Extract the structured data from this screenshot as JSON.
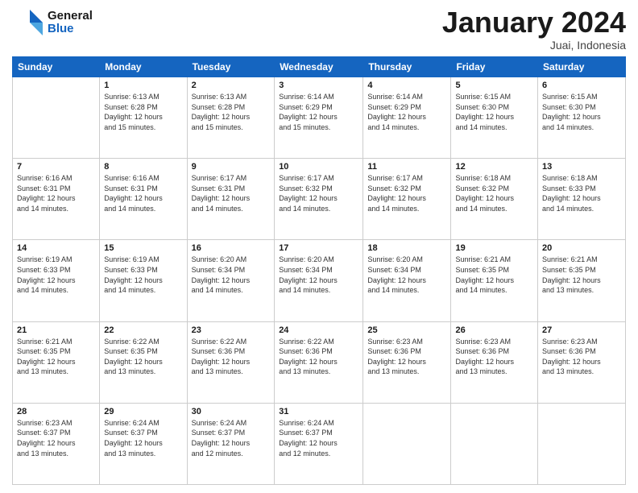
{
  "header": {
    "logo_general": "General",
    "logo_blue": "Blue",
    "month_title": "January 2024",
    "location": "Juai, Indonesia"
  },
  "days_of_week": [
    "Sunday",
    "Monday",
    "Tuesday",
    "Wednesday",
    "Thursday",
    "Friday",
    "Saturday"
  ],
  "weeks": [
    [
      {
        "num": "",
        "info": ""
      },
      {
        "num": "1",
        "info": "Sunrise: 6:13 AM\nSunset: 6:28 PM\nDaylight: 12 hours\nand 15 minutes."
      },
      {
        "num": "2",
        "info": "Sunrise: 6:13 AM\nSunset: 6:28 PM\nDaylight: 12 hours\nand 15 minutes."
      },
      {
        "num": "3",
        "info": "Sunrise: 6:14 AM\nSunset: 6:29 PM\nDaylight: 12 hours\nand 15 minutes."
      },
      {
        "num": "4",
        "info": "Sunrise: 6:14 AM\nSunset: 6:29 PM\nDaylight: 12 hours\nand 14 minutes."
      },
      {
        "num": "5",
        "info": "Sunrise: 6:15 AM\nSunset: 6:30 PM\nDaylight: 12 hours\nand 14 minutes."
      },
      {
        "num": "6",
        "info": "Sunrise: 6:15 AM\nSunset: 6:30 PM\nDaylight: 12 hours\nand 14 minutes."
      }
    ],
    [
      {
        "num": "7",
        "info": "Sunrise: 6:16 AM\nSunset: 6:31 PM\nDaylight: 12 hours\nand 14 minutes."
      },
      {
        "num": "8",
        "info": "Sunrise: 6:16 AM\nSunset: 6:31 PM\nDaylight: 12 hours\nand 14 minutes."
      },
      {
        "num": "9",
        "info": "Sunrise: 6:17 AM\nSunset: 6:31 PM\nDaylight: 12 hours\nand 14 minutes."
      },
      {
        "num": "10",
        "info": "Sunrise: 6:17 AM\nSunset: 6:32 PM\nDaylight: 12 hours\nand 14 minutes."
      },
      {
        "num": "11",
        "info": "Sunrise: 6:17 AM\nSunset: 6:32 PM\nDaylight: 12 hours\nand 14 minutes."
      },
      {
        "num": "12",
        "info": "Sunrise: 6:18 AM\nSunset: 6:32 PM\nDaylight: 12 hours\nand 14 minutes."
      },
      {
        "num": "13",
        "info": "Sunrise: 6:18 AM\nSunset: 6:33 PM\nDaylight: 12 hours\nand 14 minutes."
      }
    ],
    [
      {
        "num": "14",
        "info": "Sunrise: 6:19 AM\nSunset: 6:33 PM\nDaylight: 12 hours\nand 14 minutes."
      },
      {
        "num": "15",
        "info": "Sunrise: 6:19 AM\nSunset: 6:33 PM\nDaylight: 12 hours\nand 14 minutes."
      },
      {
        "num": "16",
        "info": "Sunrise: 6:20 AM\nSunset: 6:34 PM\nDaylight: 12 hours\nand 14 minutes."
      },
      {
        "num": "17",
        "info": "Sunrise: 6:20 AM\nSunset: 6:34 PM\nDaylight: 12 hours\nand 14 minutes."
      },
      {
        "num": "18",
        "info": "Sunrise: 6:20 AM\nSunset: 6:34 PM\nDaylight: 12 hours\nand 14 minutes."
      },
      {
        "num": "19",
        "info": "Sunrise: 6:21 AM\nSunset: 6:35 PM\nDaylight: 12 hours\nand 14 minutes."
      },
      {
        "num": "20",
        "info": "Sunrise: 6:21 AM\nSunset: 6:35 PM\nDaylight: 12 hours\nand 13 minutes."
      }
    ],
    [
      {
        "num": "21",
        "info": "Sunrise: 6:21 AM\nSunset: 6:35 PM\nDaylight: 12 hours\nand 13 minutes."
      },
      {
        "num": "22",
        "info": "Sunrise: 6:22 AM\nSunset: 6:35 PM\nDaylight: 12 hours\nand 13 minutes."
      },
      {
        "num": "23",
        "info": "Sunrise: 6:22 AM\nSunset: 6:36 PM\nDaylight: 12 hours\nand 13 minutes."
      },
      {
        "num": "24",
        "info": "Sunrise: 6:22 AM\nSunset: 6:36 PM\nDaylight: 12 hours\nand 13 minutes."
      },
      {
        "num": "25",
        "info": "Sunrise: 6:23 AM\nSunset: 6:36 PM\nDaylight: 12 hours\nand 13 minutes."
      },
      {
        "num": "26",
        "info": "Sunrise: 6:23 AM\nSunset: 6:36 PM\nDaylight: 12 hours\nand 13 minutes."
      },
      {
        "num": "27",
        "info": "Sunrise: 6:23 AM\nSunset: 6:36 PM\nDaylight: 12 hours\nand 13 minutes."
      }
    ],
    [
      {
        "num": "28",
        "info": "Sunrise: 6:23 AM\nSunset: 6:37 PM\nDaylight: 12 hours\nand 13 minutes."
      },
      {
        "num": "29",
        "info": "Sunrise: 6:24 AM\nSunset: 6:37 PM\nDaylight: 12 hours\nand 13 minutes."
      },
      {
        "num": "30",
        "info": "Sunrise: 6:24 AM\nSunset: 6:37 PM\nDaylight: 12 hours\nand 12 minutes."
      },
      {
        "num": "31",
        "info": "Sunrise: 6:24 AM\nSunset: 6:37 PM\nDaylight: 12 hours\nand 12 minutes."
      },
      {
        "num": "",
        "info": ""
      },
      {
        "num": "",
        "info": ""
      },
      {
        "num": "",
        "info": ""
      }
    ]
  ]
}
